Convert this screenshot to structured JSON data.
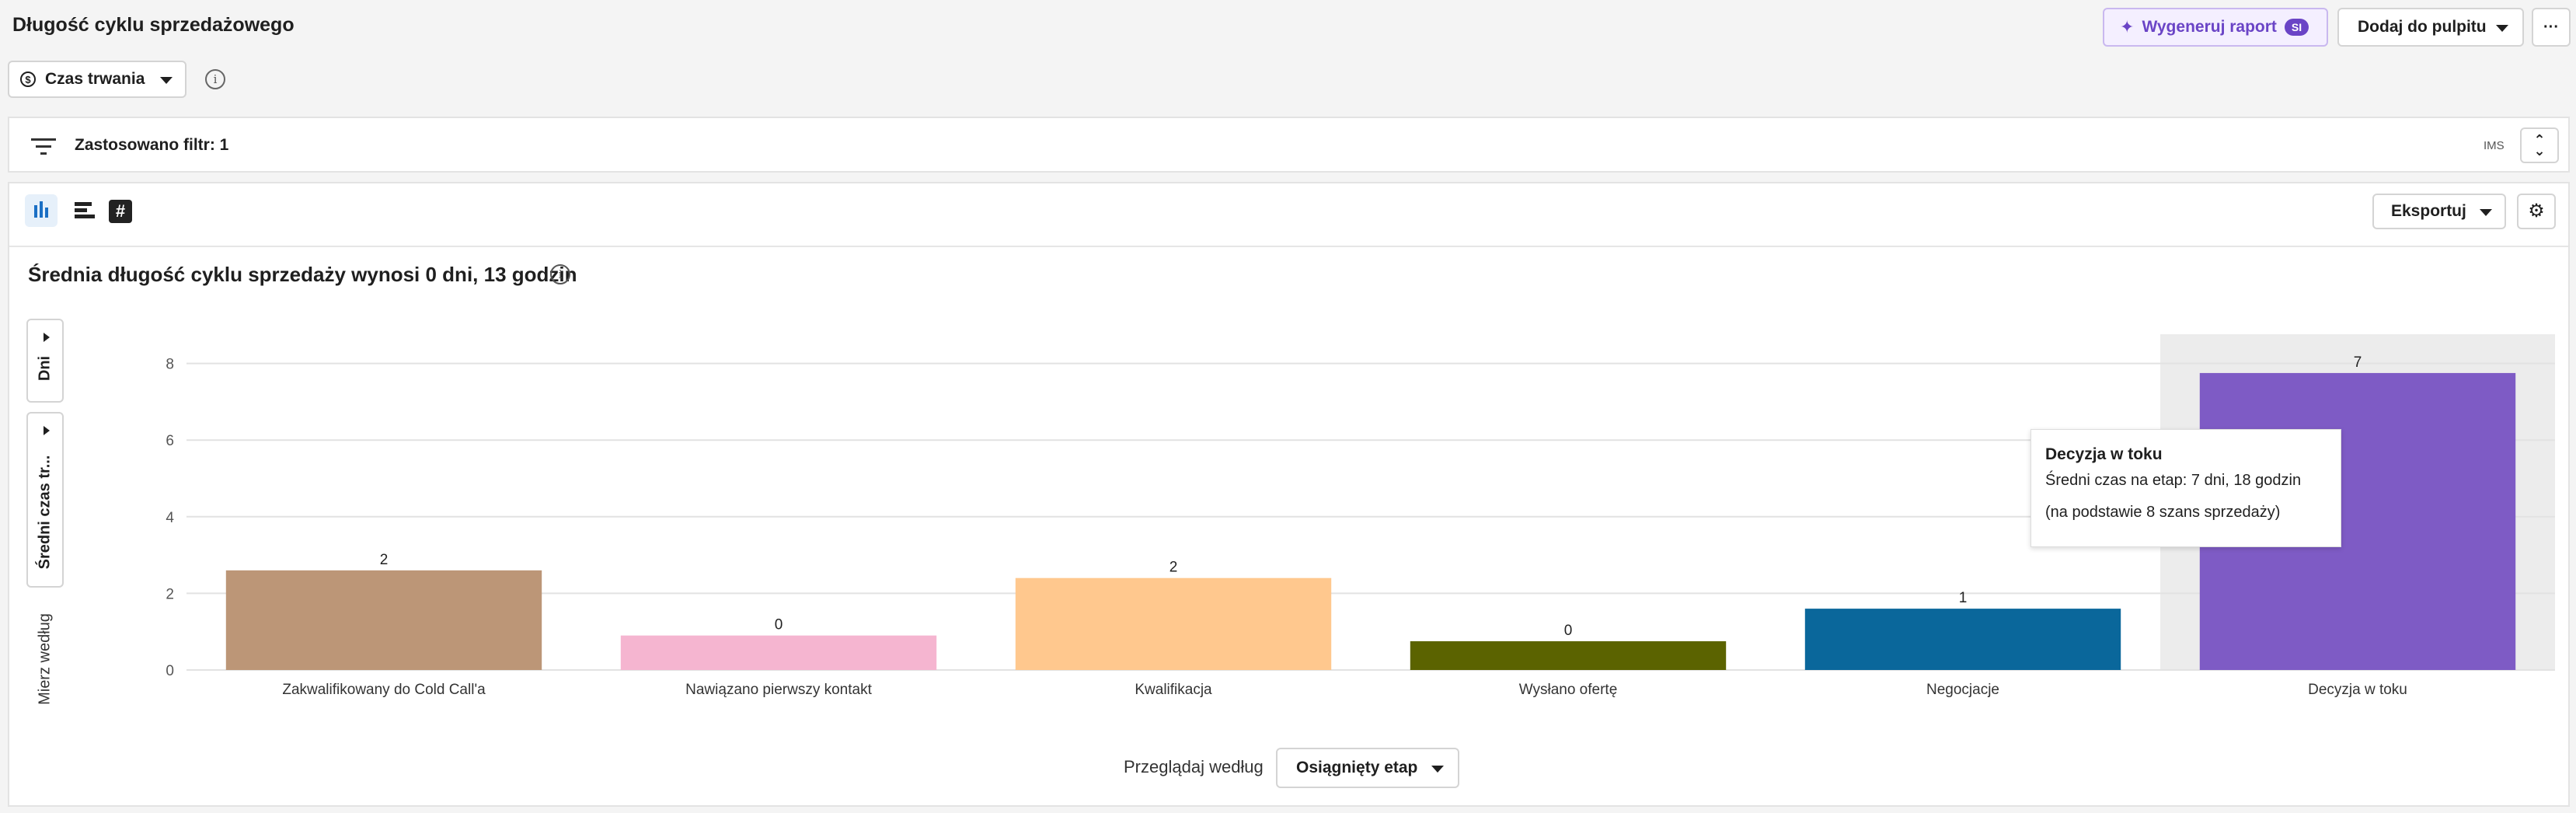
{
  "page": {
    "title": "Długość cyklu sprzedażowego",
    "generate_report_label": "Wygeneruj raport",
    "ai_badge": "SI",
    "add_to_dashboard_label": "Dodaj do pulpitu",
    "more_label": "···"
  },
  "measure_select": {
    "label": "Czas trwania"
  },
  "filter_bar": {
    "label": "Zastosowano filtr: 1",
    "right_tag": "IMS"
  },
  "toolbar": {
    "export_label": "Eksportuj"
  },
  "summary": {
    "title": "Średnia długość cyklu sprzedaży wynosi 0 dni, 13 godzin"
  },
  "side_controls": {
    "unit_label": "Dni",
    "metric_label": "Średni czas tr...",
    "measure_by_label": "Mierz według"
  },
  "footer": {
    "browse_by_label": "Przeglądaj według",
    "browse_by_value": "Osiągnięty etap"
  },
  "tooltip": {
    "title": "Decyzja w toku",
    "line1": "Średni czas na etap: 7 dni, 18 godzin",
    "line2": "(na podstawie 8 szans sprzedaży)"
  },
  "chart_data": {
    "type": "bar",
    "title": "",
    "xlabel": "",
    "ylabel": "",
    "ylim": [
      0,
      8.5
    ],
    "yticks": [
      0,
      2,
      4,
      6,
      8
    ],
    "grid": true,
    "highlighted_category": "Decyzja w toku",
    "categories": [
      "Zakwalifikowany do Cold Call'a",
      "Nawiązano pierwszy kontakt",
      "Kwalifikacja",
      "Wysłano ofertę",
      "Negocjacje",
      "Decyzja w toku"
    ],
    "values": [
      2.6,
      0.9,
      2.4,
      0.75,
      1.6,
      7.75
    ],
    "data_labels": [
      "2",
      "0",
      "2",
      "0",
      "1",
      "7"
    ],
    "colors": [
      "#bc9677",
      "#f5b5d0",
      "#ffc88e",
      "#5b6300",
      "#0a679b",
      "#7e5bc5"
    ]
  }
}
